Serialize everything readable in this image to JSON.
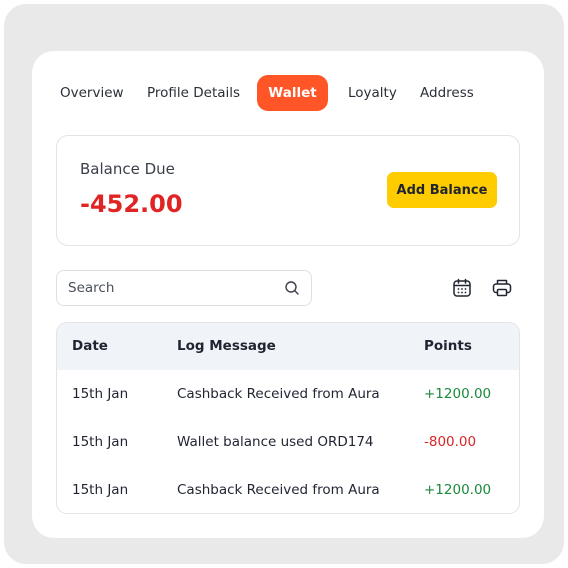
{
  "tabs": [
    {
      "label": "Overview"
    },
    {
      "label": "Profile Details"
    },
    {
      "label": "Wallet",
      "active": true
    },
    {
      "label": "Loyalty"
    },
    {
      "label": "Address"
    }
  ],
  "balance": {
    "label": "Balance Due",
    "value": "-452.00",
    "add_button_label": "Add Balance"
  },
  "search": {
    "placeholder": "Search",
    "value": ""
  },
  "icons": {
    "calendar": "calendar-icon",
    "print": "printer-icon",
    "search": "search-icon"
  },
  "table": {
    "headers": [
      "Date",
      "Log Message",
      "Points"
    ],
    "rows": [
      {
        "date": "15th Jan",
        "message": "Cashback Received from Aura",
        "points": "+1200.00",
        "type": "credit"
      },
      {
        "date": "15th Jan",
        "message": "Wallet balance used ORD174",
        "points": "-800.00",
        "type": "debit"
      },
      {
        "date": "15th Jan",
        "message": "Cashback Received from Aura",
        "points": "+1200.00",
        "type": "credit"
      }
    ]
  },
  "colors": {
    "accent": "#ff5527",
    "button": "#ffcc00",
    "negative": "#e02424",
    "positive": "#1a8a3a"
  }
}
